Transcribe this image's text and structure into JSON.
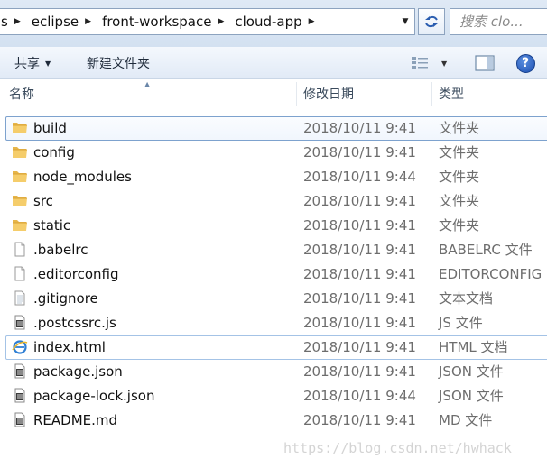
{
  "address_bar": {
    "breadcrumbs": [
      "s",
      "eclipse",
      "front-workspace",
      "cloud-app"
    ],
    "search_placeholder": "搜索 clo..."
  },
  "toolbar": {
    "share_label": "共享",
    "new_folder_label": "新建文件夹"
  },
  "columns": {
    "name": "名称",
    "date": "修改日期",
    "type": "类型"
  },
  "files": [
    {
      "name": "build",
      "date": "2018/10/11 9:41",
      "type": "文件夹",
      "icon": "folder-icon"
    },
    {
      "name": "config",
      "date": "2018/10/11 9:41",
      "type": "文件夹",
      "icon": "folder-icon"
    },
    {
      "name": "node_modules",
      "date": "2018/10/11 9:44",
      "type": "文件夹",
      "icon": "folder-icon"
    },
    {
      "name": "src",
      "date": "2018/10/11 9:41",
      "type": "文件夹",
      "icon": "folder-icon"
    },
    {
      "name": "static",
      "date": "2018/10/11 9:41",
      "type": "文件夹",
      "icon": "folder-icon"
    },
    {
      "name": ".babelrc",
      "date": "2018/10/11 9:41",
      "type": "BABELRC 文件",
      "icon": "blank-file-icon"
    },
    {
      "name": ".editorconfig",
      "date": "2018/10/11 9:41",
      "type": "EDITORCONFIG ...",
      "icon": "blank-file-icon"
    },
    {
      "name": ".gitignore",
      "date": "2018/10/11 9:41",
      "type": "文本文档",
      "icon": "text-file-icon"
    },
    {
      "name": ".postcssrc.js",
      "date": "2018/10/11 9:41",
      "type": "JS 文件",
      "icon": "script-file-icon"
    },
    {
      "name": "index.html",
      "date": "2018/10/11 9:41",
      "type": "HTML 文档",
      "icon": "ie-html-icon"
    },
    {
      "name": "package.json",
      "date": "2018/10/11 9:41",
      "type": "JSON 文件",
      "icon": "script-file-icon"
    },
    {
      "name": "package-lock.json",
      "date": "2018/10/11 9:44",
      "type": "JSON 文件",
      "icon": "script-file-icon"
    },
    {
      "name": "README.md",
      "date": "2018/10/11 9:41",
      "type": "MD 文件",
      "icon": "script-file-icon"
    }
  ],
  "watermark": "https://blog.csdn.net/hwhack"
}
